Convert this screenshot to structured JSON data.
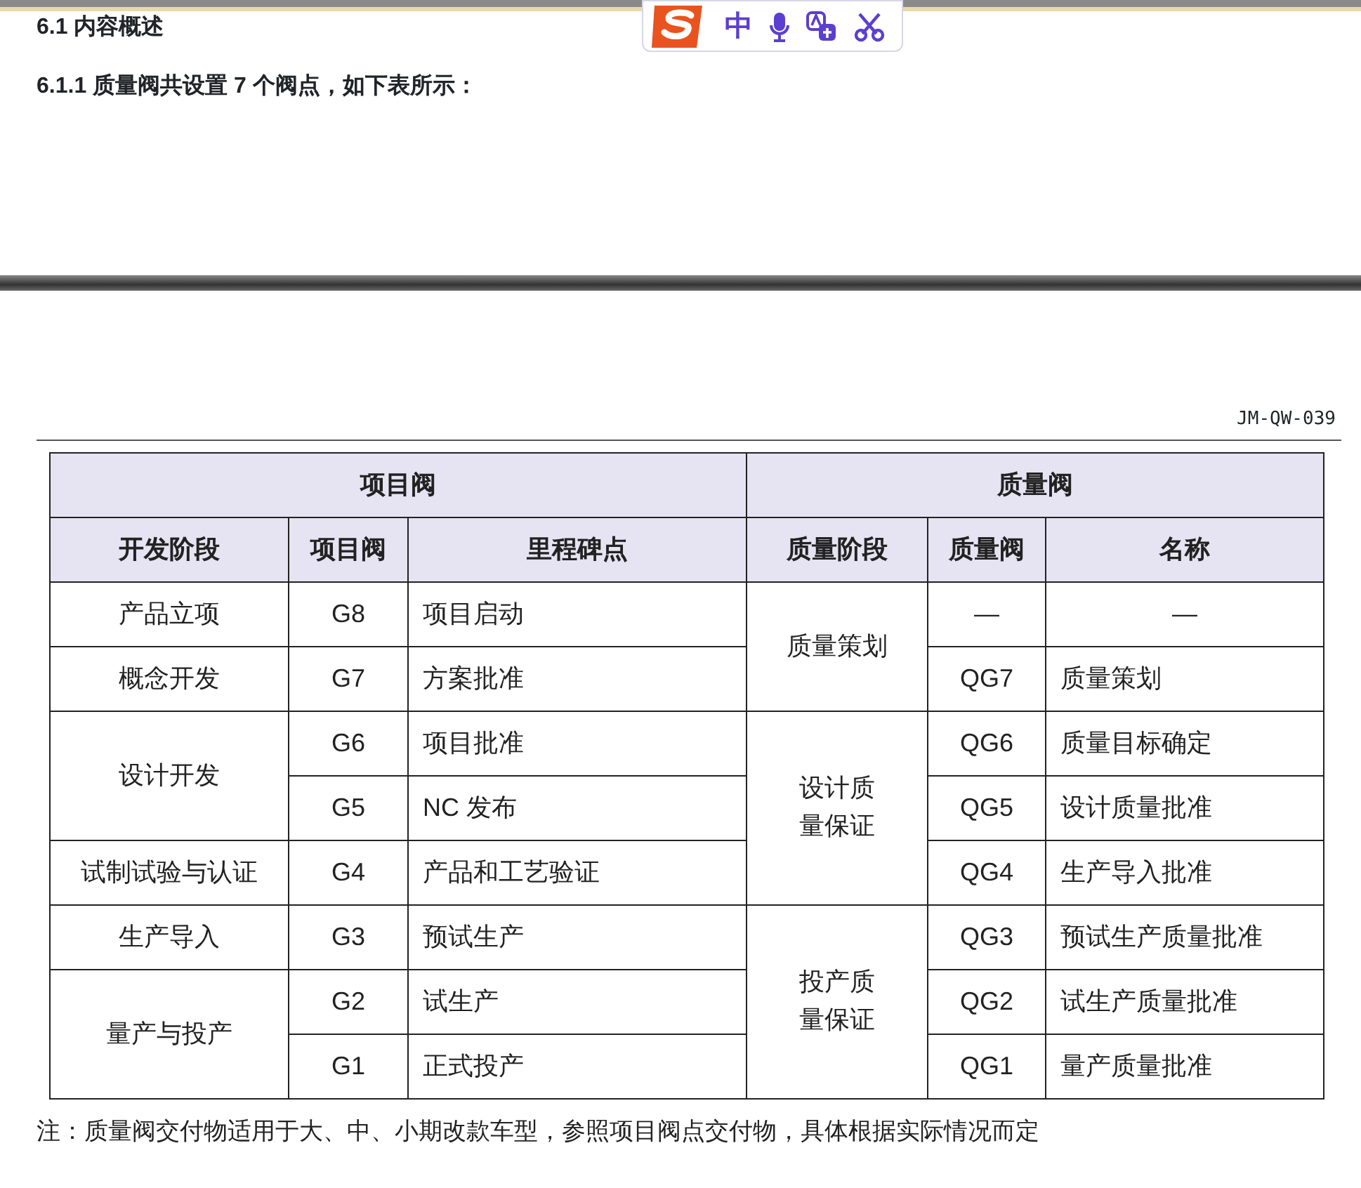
{
  "top_page": {
    "section_heading": "6.1 内容概述",
    "subsection_heading": "6.1.1 质量阀共设置 7 个阀点，如下表所示："
  },
  "ime_toolbar": {
    "mode_label": "中"
  },
  "doc_code": "JM-QW-039",
  "table": {
    "group_headers": [
      "项目阀",
      "质量阀"
    ],
    "columns": [
      "开发阶段",
      "项目阀",
      "里程碑点",
      "质量阶段",
      "质量阀",
      "名称"
    ],
    "project_phases": [
      {
        "name": "产品立项",
        "gates": [
          {
            "gate": "G8",
            "milestone": "项目启动"
          }
        ]
      },
      {
        "name": "概念开发",
        "gates": [
          {
            "gate": "G7",
            "milestone": "方案批准"
          }
        ]
      },
      {
        "name": "设计开发",
        "gates": [
          {
            "gate": "G6",
            "milestone": "项目批准"
          },
          {
            "gate": "G5",
            "milestone": "NC 发布"
          }
        ]
      },
      {
        "name": "试制试验与认证",
        "gates": [
          {
            "gate": "G4",
            "milestone": "产品和工艺验证"
          }
        ]
      },
      {
        "name": "生产导入",
        "gates": [
          {
            "gate": "G3",
            "milestone": "预试生产"
          }
        ]
      },
      {
        "name": "量产与投产",
        "gates": [
          {
            "gate": "G2",
            "milestone": "试生产"
          },
          {
            "gate": "G1",
            "milestone": "正式投产"
          }
        ]
      }
    ],
    "quality_phases": [
      {
        "name": "质量策划",
        "gates": [
          {
            "gate": "—",
            "name": "—"
          },
          {
            "gate": "QG7",
            "name": "质量策划"
          }
        ]
      },
      {
        "name": "设计质量保证",
        "gates": [
          {
            "gate": "QG6",
            "name": "质量目标确定"
          },
          {
            "gate": "QG5",
            "name": "设计质量批准"
          },
          {
            "gate": "QG4",
            "name": "生产导入批准"
          }
        ]
      },
      {
        "name": "投产质量保证",
        "gates": [
          {
            "gate": "QG3",
            "name": "预试生产质量批准"
          },
          {
            "gate": "QG2",
            "name": "试生产质量批准"
          },
          {
            "gate": "QG1",
            "name": "量产质量批准"
          }
        ]
      }
    ]
  },
  "note": "注：质量阀交付物适用于大、中、小期改款车型，参照项目阀点交付物，具体根据实际情况而定"
}
